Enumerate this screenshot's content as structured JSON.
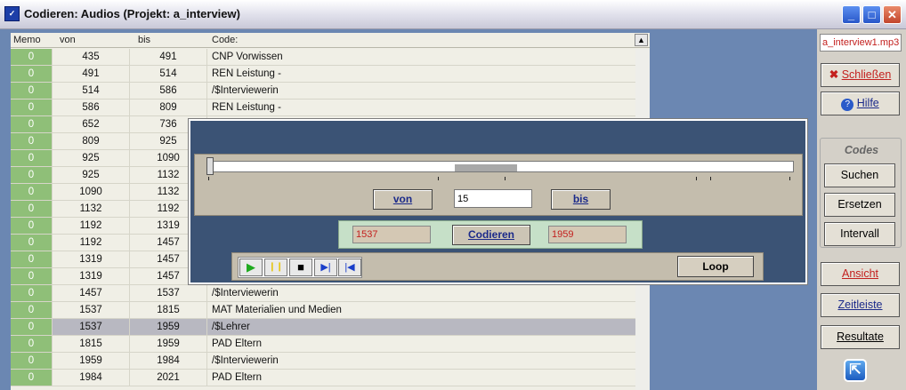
{
  "window": {
    "title": "Codieren: Audios (Projekt: a_interview)",
    "icon": "app-icon"
  },
  "table": {
    "headers": [
      "Memo",
      "von",
      "bis",
      "Code:"
    ],
    "rows": [
      {
        "memo": "0",
        "von": "435",
        "bis": "491",
        "code": "CNP Vorwissen"
      },
      {
        "memo": "0",
        "von": "491",
        "bis": "514",
        "code": "REN Leistung -"
      },
      {
        "memo": "0",
        "von": "514",
        "bis": "586",
        "code": "/$Interviewerin"
      },
      {
        "memo": "0",
        "von": "586",
        "bis": "809",
        "code": "REN Leistung -"
      },
      {
        "memo": "0",
        "von": "652",
        "bis": "736",
        "code": ""
      },
      {
        "memo": "0",
        "von": "809",
        "bis": "925",
        "code": ""
      },
      {
        "memo": "0",
        "von": "925",
        "bis": "1090",
        "code": ""
      },
      {
        "memo": "0",
        "von": "925",
        "bis": "1132",
        "code": ""
      },
      {
        "memo": "0",
        "von": "1090",
        "bis": "1132",
        "code": ""
      },
      {
        "memo": "0",
        "von": "1132",
        "bis": "1192",
        "code": ""
      },
      {
        "memo": "0",
        "von": "1192",
        "bis": "1319",
        "code": ""
      },
      {
        "memo": "0",
        "von": "1192",
        "bis": "1457",
        "code": ""
      },
      {
        "memo": "0",
        "von": "1319",
        "bis": "1457",
        "code": ""
      },
      {
        "memo": "0",
        "von": "1319",
        "bis": "1457",
        "code": ""
      },
      {
        "memo": "0",
        "von": "1457",
        "bis": "1537",
        "code": "/$Interviewerin"
      },
      {
        "memo": "0",
        "von": "1537",
        "bis": "1815",
        "code": "MAT Materialien und Medien"
      },
      {
        "memo": "0",
        "von": "1537",
        "bis": "1959",
        "code": "/$Lehrer",
        "selected": true
      },
      {
        "memo": "0",
        "von": "1815",
        "bis": "1959",
        "code": "PAD Eltern"
      },
      {
        "memo": "0",
        "von": "1959",
        "bis": "1984",
        "code": "/$Interviewerin"
      },
      {
        "memo": "0",
        "von": "1984",
        "bis": "2021",
        "code": "PAD Eltern"
      }
    ]
  },
  "player": {
    "von_label": "von",
    "bis_label": "bis",
    "interval_value": "15",
    "start_value": "1537",
    "end_value": "1959",
    "codieren_label": "Codieren",
    "loop_label": "Loop",
    "controls": [
      {
        "icon": "play-icon",
        "glyph": "▶"
      },
      {
        "icon": "pause-icon",
        "glyph": "❙❙"
      },
      {
        "icon": "stop-icon",
        "glyph": "■"
      },
      {
        "icon": "skip-end-icon",
        "glyph": "▶|"
      },
      {
        "icon": "skip-start-icon",
        "glyph": "|◀"
      }
    ]
  },
  "sidebar": {
    "file": "a_interview1.mp3",
    "schliessen": "Schließen",
    "hilfe": "Hilfe",
    "codes_title": "Codes",
    "suchen": "Suchen",
    "ersetzen": "Ersetzen",
    "intervall": "Intervall",
    "ansicht": "Ansicht",
    "zeitleiste": "Zeitleiste",
    "resultate": "Resultate"
  },
  "colors": {
    "memo_green": "#8fbf78",
    "panel_blue": "#3b5375",
    "accent_red": "#c3201e",
    "link_blue": "#1b2a8a"
  }
}
